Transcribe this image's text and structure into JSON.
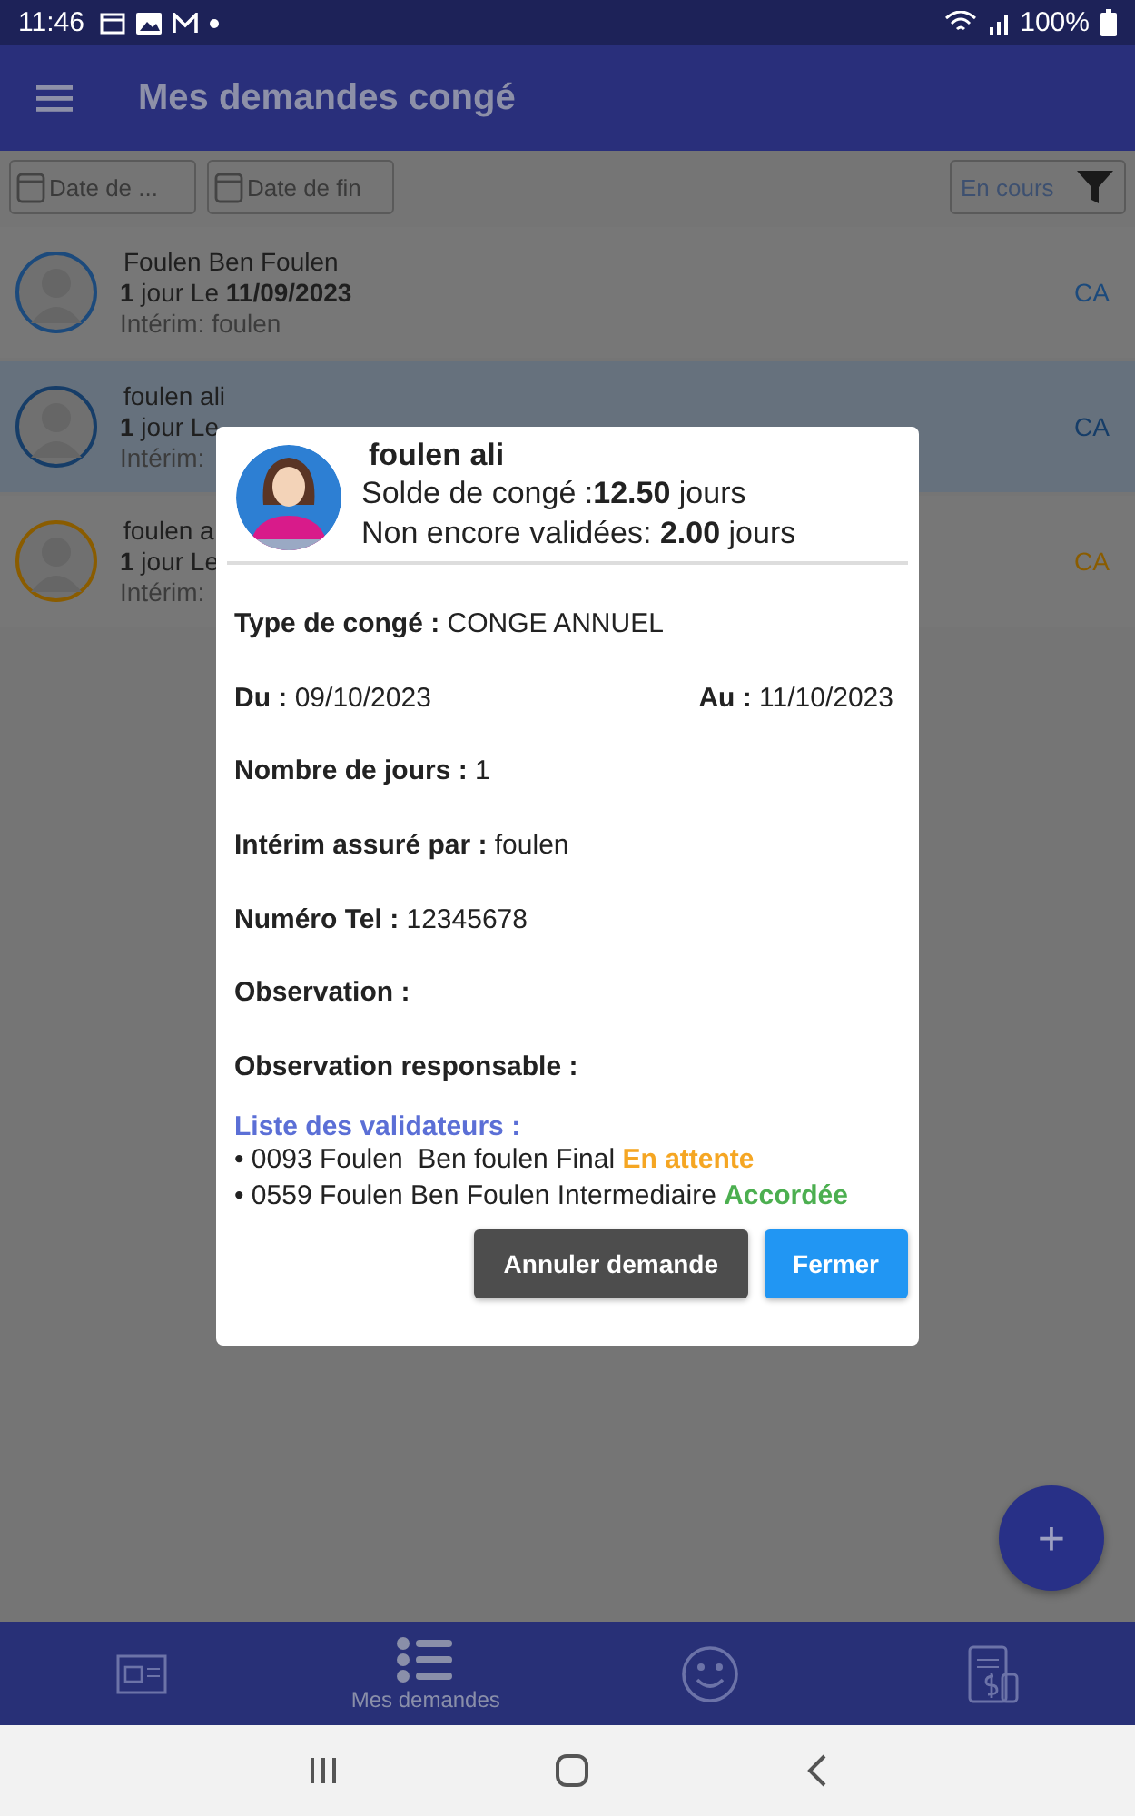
{
  "status_bar": {
    "time": "11:46",
    "battery": "100%"
  },
  "app_bar": {
    "title": "Mes demandes congé"
  },
  "filters": {
    "start_date": {
      "placeholder": "Date de ..."
    },
    "end_date": {
      "placeholder": "Date de fin"
    },
    "status": {
      "value": "En cours"
    }
  },
  "requests": [
    {
      "name": "Foulen Ben Foulen",
      "line": "**1** jour Le **11/09/2023**",
      "interim": "Intérim: foulen",
      "type": "CA",
      "color": "#1c4a7c",
      "selected": false
    },
    {
      "name": "foulen ali",
      "line": "**1** jour Le",
      "interim": "Intérim:",
      "type": "CA",
      "color": "#163d68",
      "selected": true
    },
    {
      "name": "foulen a",
      "line": "**1** jour Le",
      "interim": "Intérim:",
      "type": "CA",
      "color": "#8a5c00",
      "selected": false
    }
  ],
  "dialog": {
    "name": "foulen ali",
    "balance": "Solde de congé :**12.50** jours",
    "pending": "Non encore validées: **2.00** jours",
    "fields": [
      {
        "kind": "single",
        "label": "Type de congé :",
        "value": "CONGE ANNUEL"
      },
      {
        "kind": "pair",
        "label": "Du :",
        "value": "09/10/2023",
        "label2": "Au :",
        "value2": "11/10/2023"
      },
      {
        "kind": "single",
        "label": "Nombre de jours :",
        "value": "1"
      },
      {
        "kind": "single",
        "label": "Intérim assuré par :",
        "value": "foulen"
      },
      {
        "kind": "single",
        "label": "Numéro Tel :",
        "value": "12345678"
      },
      {
        "kind": "single",
        "label": "Observation :"
      },
      {
        "kind": "single",
        "label": "Observation responsable :"
      }
    ],
    "validators_title": "Liste des validateurs :",
    "validators": [
      {
        "text": "• 0093 Foulen  Ben foulen Final",
        "status": "En attente",
        "color": "#f5a623"
      },
      {
        "text": "• 0559 Foulen Ben Foulen Intermediaire",
        "status": "Accordée",
        "color": "#4caf50"
      }
    ],
    "buttons": [
      {
        "label": "Annuler demande",
        "kind": "secondary"
      },
      {
        "label": "Fermer",
        "kind": "primary"
      }
    ]
  },
  "fab": {
    "label": "+"
  },
  "bottom_nav": [
    {
      "selected": false
    },
    {
      "label": "Mes demandes",
      "selected": true
    },
    {
      "selected": false
    },
    {
      "selected": false
    }
  ]
}
